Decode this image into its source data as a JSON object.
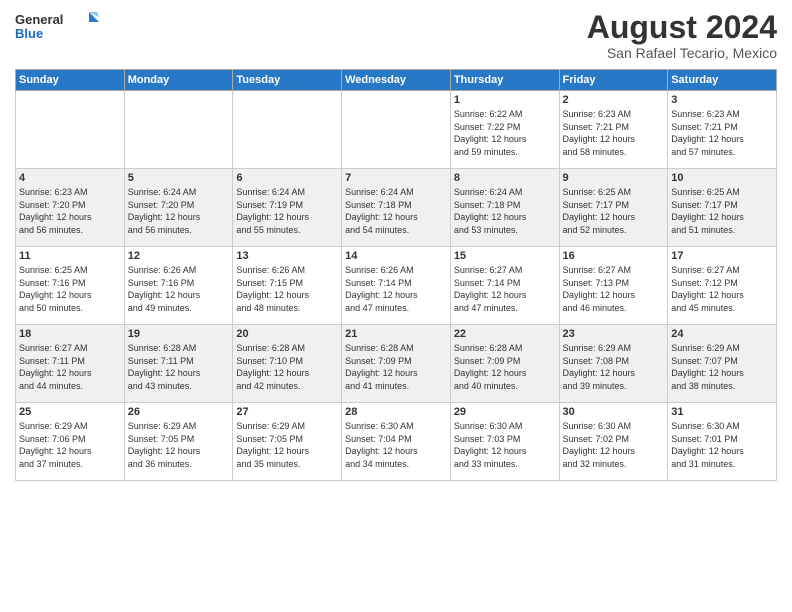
{
  "logo": {
    "general": "General",
    "blue": "Blue"
  },
  "title": "August 2024",
  "subtitle": "San Rafael Tecario, Mexico",
  "weekdays": [
    "Sunday",
    "Monday",
    "Tuesday",
    "Wednesday",
    "Thursday",
    "Friday",
    "Saturday"
  ],
  "weeks": [
    [
      {
        "day": "",
        "info": ""
      },
      {
        "day": "",
        "info": ""
      },
      {
        "day": "",
        "info": ""
      },
      {
        "day": "",
        "info": ""
      },
      {
        "day": "1",
        "info": "Sunrise: 6:22 AM\nSunset: 7:22 PM\nDaylight: 12 hours\nand 59 minutes."
      },
      {
        "day": "2",
        "info": "Sunrise: 6:23 AM\nSunset: 7:21 PM\nDaylight: 12 hours\nand 58 minutes."
      },
      {
        "day": "3",
        "info": "Sunrise: 6:23 AM\nSunset: 7:21 PM\nDaylight: 12 hours\nand 57 minutes."
      }
    ],
    [
      {
        "day": "4",
        "info": "Sunrise: 6:23 AM\nSunset: 7:20 PM\nDaylight: 12 hours\nand 56 minutes."
      },
      {
        "day": "5",
        "info": "Sunrise: 6:24 AM\nSunset: 7:20 PM\nDaylight: 12 hours\nand 56 minutes."
      },
      {
        "day": "6",
        "info": "Sunrise: 6:24 AM\nSunset: 7:19 PM\nDaylight: 12 hours\nand 55 minutes."
      },
      {
        "day": "7",
        "info": "Sunrise: 6:24 AM\nSunset: 7:18 PM\nDaylight: 12 hours\nand 54 minutes."
      },
      {
        "day": "8",
        "info": "Sunrise: 6:24 AM\nSunset: 7:18 PM\nDaylight: 12 hours\nand 53 minutes."
      },
      {
        "day": "9",
        "info": "Sunrise: 6:25 AM\nSunset: 7:17 PM\nDaylight: 12 hours\nand 52 minutes."
      },
      {
        "day": "10",
        "info": "Sunrise: 6:25 AM\nSunset: 7:17 PM\nDaylight: 12 hours\nand 51 minutes."
      }
    ],
    [
      {
        "day": "11",
        "info": "Sunrise: 6:25 AM\nSunset: 7:16 PM\nDaylight: 12 hours\nand 50 minutes."
      },
      {
        "day": "12",
        "info": "Sunrise: 6:26 AM\nSunset: 7:16 PM\nDaylight: 12 hours\nand 49 minutes."
      },
      {
        "day": "13",
        "info": "Sunrise: 6:26 AM\nSunset: 7:15 PM\nDaylight: 12 hours\nand 48 minutes."
      },
      {
        "day": "14",
        "info": "Sunrise: 6:26 AM\nSunset: 7:14 PM\nDaylight: 12 hours\nand 47 minutes."
      },
      {
        "day": "15",
        "info": "Sunrise: 6:27 AM\nSunset: 7:14 PM\nDaylight: 12 hours\nand 47 minutes."
      },
      {
        "day": "16",
        "info": "Sunrise: 6:27 AM\nSunset: 7:13 PM\nDaylight: 12 hours\nand 46 minutes."
      },
      {
        "day": "17",
        "info": "Sunrise: 6:27 AM\nSunset: 7:12 PM\nDaylight: 12 hours\nand 45 minutes."
      }
    ],
    [
      {
        "day": "18",
        "info": "Sunrise: 6:27 AM\nSunset: 7:11 PM\nDaylight: 12 hours\nand 44 minutes."
      },
      {
        "day": "19",
        "info": "Sunrise: 6:28 AM\nSunset: 7:11 PM\nDaylight: 12 hours\nand 43 minutes."
      },
      {
        "day": "20",
        "info": "Sunrise: 6:28 AM\nSunset: 7:10 PM\nDaylight: 12 hours\nand 42 minutes."
      },
      {
        "day": "21",
        "info": "Sunrise: 6:28 AM\nSunset: 7:09 PM\nDaylight: 12 hours\nand 41 minutes."
      },
      {
        "day": "22",
        "info": "Sunrise: 6:28 AM\nSunset: 7:09 PM\nDaylight: 12 hours\nand 40 minutes."
      },
      {
        "day": "23",
        "info": "Sunrise: 6:29 AM\nSunset: 7:08 PM\nDaylight: 12 hours\nand 39 minutes."
      },
      {
        "day": "24",
        "info": "Sunrise: 6:29 AM\nSunset: 7:07 PM\nDaylight: 12 hours\nand 38 minutes."
      }
    ],
    [
      {
        "day": "25",
        "info": "Sunrise: 6:29 AM\nSunset: 7:06 PM\nDaylight: 12 hours\nand 37 minutes."
      },
      {
        "day": "26",
        "info": "Sunrise: 6:29 AM\nSunset: 7:05 PM\nDaylight: 12 hours\nand 36 minutes."
      },
      {
        "day": "27",
        "info": "Sunrise: 6:29 AM\nSunset: 7:05 PM\nDaylight: 12 hours\nand 35 minutes."
      },
      {
        "day": "28",
        "info": "Sunrise: 6:30 AM\nSunset: 7:04 PM\nDaylight: 12 hours\nand 34 minutes."
      },
      {
        "day": "29",
        "info": "Sunrise: 6:30 AM\nSunset: 7:03 PM\nDaylight: 12 hours\nand 33 minutes."
      },
      {
        "day": "30",
        "info": "Sunrise: 6:30 AM\nSunset: 7:02 PM\nDaylight: 12 hours\nand 32 minutes."
      },
      {
        "day": "31",
        "info": "Sunrise: 6:30 AM\nSunset: 7:01 PM\nDaylight: 12 hours\nand 31 minutes."
      }
    ]
  ]
}
